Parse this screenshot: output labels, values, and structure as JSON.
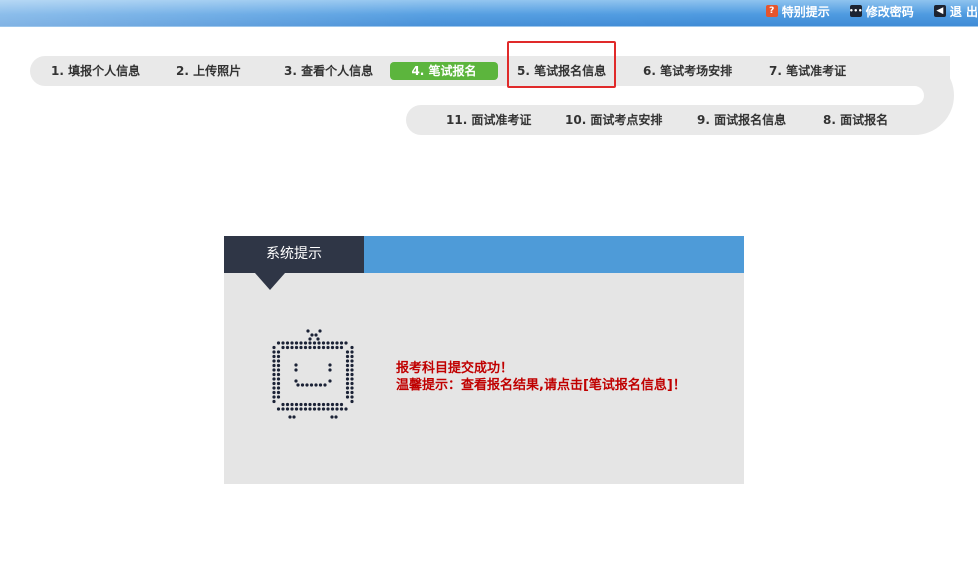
{
  "header": {
    "links": [
      {
        "icon": "special-tip-icon",
        "label": "特别提示"
      },
      {
        "icon": "change-password-icon",
        "label": "修改密码"
      },
      {
        "icon": "logout-icon",
        "label": "退 出"
      }
    ]
  },
  "steps": {
    "row1": [
      {
        "label": "1. 填报个人信息"
      },
      {
        "label": "2. 上传照片"
      },
      {
        "label": "3. 查看个人信息"
      },
      {
        "label": "4. 笔试报名",
        "active": true
      },
      {
        "label": "5. 笔试报名信息",
        "highlighted": true
      },
      {
        "label": "6. 笔试考场安排"
      },
      {
        "label": "7. 笔试准考证"
      }
    ],
    "row2": [
      {
        "label": "11. 面试准考证"
      },
      {
        "label": "10. 面试考点安排"
      },
      {
        "label": "9. 面试报名信息"
      },
      {
        "label": "8. 面试报名"
      }
    ]
  },
  "panel": {
    "title": "系统提示",
    "message_line1": "报考科目提交成功！",
    "message_line2": "温馨提示：查看报名结果,请点击[笔试报名信息]！",
    "icon": "robot-tv-icon",
    "colors": {
      "header": "#4e9bd8",
      "tab": "#2f3646",
      "message": "#c00000",
      "active_step": "#5cb53d",
      "highlight": "#e02a2a"
    }
  }
}
